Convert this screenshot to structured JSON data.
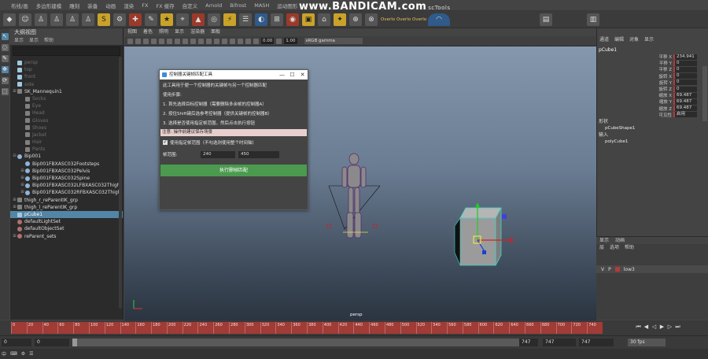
{
  "menubar": {
    "items": [
      "布线/画",
      "多边形建模",
      "雕刻",
      "装备",
      "动画",
      "渲染",
      "FX",
      "FX 缓存",
      "自定义",
      "Arnold",
      "Bifrost",
      "MASH",
      "运动图形"
    ],
    "watermark": "www.BANDICAM.com",
    "watermark_suffix": "scTools"
  },
  "shelf": {
    "labels": [
      "Overlo",
      "Overlo",
      "Overlo"
    ]
  },
  "outliner": {
    "title": "大纲视图",
    "menu": [
      "显示",
      "显示",
      "帮助"
    ],
    "items": [
      {
        "label": "persp",
        "dim": true,
        "icon": "cube"
      },
      {
        "label": "top",
        "dim": true,
        "icon": "cube"
      },
      {
        "label": "front",
        "dim": true,
        "icon": "cube"
      },
      {
        "label": "side",
        "dim": true,
        "icon": "cube"
      },
      {
        "label": "SK_Mannequin1",
        "dim": false,
        "icon": "grp",
        "exp": "⊞"
      },
      {
        "label": "Socks",
        "dim": true,
        "icon": "grp"
      },
      {
        "label": "Eye",
        "dim": true,
        "icon": "grp"
      },
      {
        "label": "Head",
        "dim": true,
        "icon": "grp"
      },
      {
        "label": "Gloves",
        "dim": true,
        "icon": "grp"
      },
      {
        "label": "Shoes",
        "dim": true,
        "icon": "grp"
      },
      {
        "label": "Jacket",
        "dim": true,
        "icon": "grp"
      },
      {
        "label": "Hair",
        "dim": true,
        "icon": "grp"
      },
      {
        "label": "Pants",
        "dim": true,
        "icon": "grp"
      },
      {
        "label": "Bip001",
        "dim": false,
        "icon": "jnt",
        "exp": "⊟"
      },
      {
        "label": "Bip001FBXASC032Footsteps",
        "dim": false,
        "icon": "jnt",
        "exp": ""
      },
      {
        "label": "Bip001FBXASC032Pelvis",
        "dim": false,
        "icon": "jnt",
        "exp": "⊞"
      },
      {
        "label": "Bip001FBXASC032Spine",
        "dim": false,
        "icon": "jnt",
        "exp": "⊞"
      },
      {
        "label": "Bip001FBXASC032LFBXASC032Thigh",
        "dim": false,
        "icon": "jnt",
        "exp": "⊞"
      },
      {
        "label": "Bip001FBXASC032RFBXASC032Thigh",
        "dim": false,
        "icon": "jnt",
        "exp": "⊞"
      },
      {
        "label": "thigh_r_reParentIK_grp",
        "dim": false,
        "icon": "grp",
        "exp": "⊞"
      },
      {
        "label": "thigh_l_reParentIK_grp",
        "dim": false,
        "icon": "grp",
        "exp": "⊞"
      },
      {
        "label": "pCube1",
        "dim": false,
        "icon": "cube",
        "selected": true
      },
      {
        "label": "defaultLightSet",
        "dim": false,
        "icon": "set"
      },
      {
        "label": "defaultObjectSet",
        "dim": false,
        "icon": "set"
      },
      {
        "label": "reParent_sets",
        "dim": false,
        "icon": "set",
        "exp": "⊞"
      }
    ]
  },
  "viewport": {
    "menu": [
      "视图",
      "着色",
      "照明",
      "显示",
      "渲染器",
      "面板"
    ],
    "exposure": "0.00",
    "gamma": "1.00",
    "colorspace": "sRGB gamma",
    "camera": "persp"
  },
  "dialog": {
    "title": "控制器关键帧匹配工具",
    "intro": "此工具用于便一个控制器的关键帧与另一个控制器匹配",
    "steps_head": "使用步骤:",
    "step1": "1. 首先选择目标控制器（需要删除多余帧的控制器A）",
    "step2": "2. 按住Shift键后选参考控制器（提供关键帧的控制器B）",
    "step3": "3. 选择是否使用指定帧范围，然后点击执行按钮",
    "note": "注意: 操作前建议保存场景",
    "checkbox_label": "使用指定帧范围（不勾选则使用整个时间轴）",
    "range_label": "帧范围:",
    "range_start": "240",
    "range_end": "450",
    "run_label": "执行删帧匹配"
  },
  "channelbox": {
    "tabs": [
      "通道",
      "编辑",
      "对象",
      "显示"
    ],
    "object": "pCube1",
    "attributes": [
      {
        "name": "平移 X",
        "value": "234.941"
      },
      {
        "name": "平移 Y",
        "value": "0"
      },
      {
        "name": "平移 Z",
        "value": "0"
      },
      {
        "name": "旋转 X",
        "value": "0"
      },
      {
        "name": "旋转 Y",
        "value": "0"
      },
      {
        "name": "旋转 Z",
        "value": "0"
      },
      {
        "name": "缩放 X",
        "value": "69.487"
      },
      {
        "name": "缩放 Y",
        "value": "69.487"
      },
      {
        "name": "缩放 Z",
        "value": "69.487"
      },
      {
        "name": "可见性",
        "value": "启用"
      }
    ],
    "shapes_label": "形状",
    "shape_name": "pCubeShape1",
    "inputs_label": "输入",
    "input_name": "polyCube1"
  },
  "layers": {
    "tabs": [
      "显示",
      "动画"
    ],
    "menu": [
      "层",
      "选项",
      "帮助"
    ],
    "row": {
      "v": "V",
      "p": "P",
      "name": "low3"
    }
  },
  "timeline": {
    "ticks": [
      "0",
      "20",
      "40",
      "60",
      "80",
      "100",
      "120",
      "140",
      "160",
      "180",
      "200",
      "220",
      "240",
      "260",
      "280",
      "300",
      "320",
      "340",
      "360",
      "380",
      "400",
      "420",
      "440",
      "460",
      "480",
      "500",
      "520",
      "540",
      "560",
      "580",
      "600",
      "620",
      "640",
      "660",
      "680",
      "700",
      "720",
      "740"
    ],
    "start": "0",
    "range_start": "0",
    "range_end": "747",
    "end_a": "747",
    "end_b": "747",
    "fps": "30 fps"
  }
}
